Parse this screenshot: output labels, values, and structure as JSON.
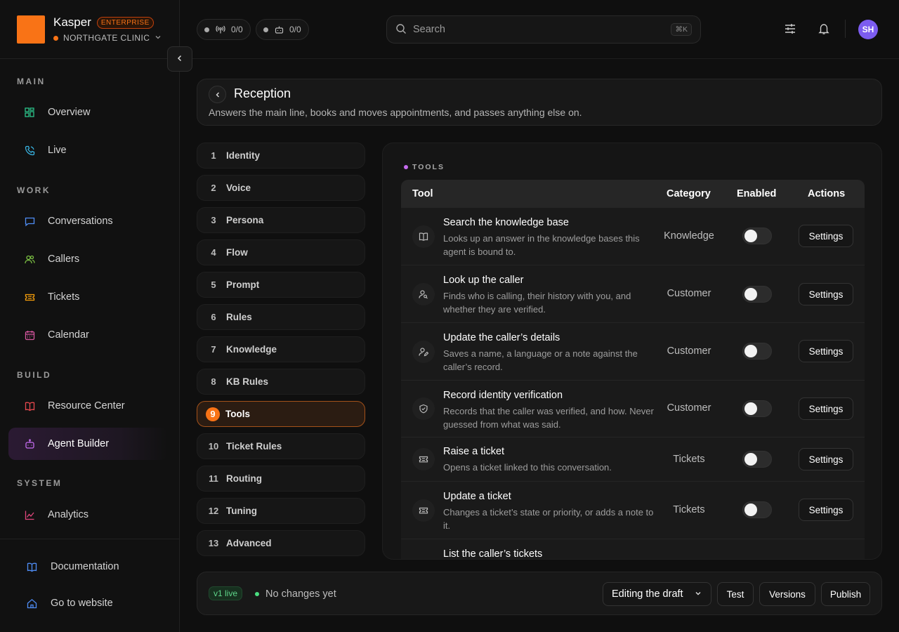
{
  "brand": {
    "name": "Kasper",
    "tier": "ENTERPRISE",
    "org": "NORTHGATE CLINIC"
  },
  "counters": [
    {
      "value": "0/0",
      "icon": "broadcast-icon"
    },
    {
      "value": "0/0",
      "icon": "bot-icon"
    }
  ],
  "search": {
    "placeholder": "Search",
    "shortcut": "⌘K"
  },
  "user": {
    "initials": "SH"
  },
  "sidebar": {
    "sections": [
      "MAIN",
      "WORK",
      "BUILD",
      "SYSTEM"
    ],
    "items": [
      {
        "label": "Overview",
        "icon": "grid-icon"
      },
      {
        "label": "Live",
        "icon": "phone-icon"
      },
      {
        "label": "Conversations",
        "icon": "message-icon"
      },
      {
        "label": "Callers",
        "icon": "users-icon"
      },
      {
        "label": "Tickets",
        "icon": "ticket-icon"
      },
      {
        "label": "Calendar",
        "icon": "calendar-icon"
      },
      {
        "label": "Resource Center",
        "icon": "book-icon"
      },
      {
        "label": "Agent Builder",
        "icon": "bot-icon",
        "active": true
      },
      {
        "label": "Analytics",
        "icon": "chart-icon"
      }
    ],
    "footer": [
      {
        "label": "Documentation",
        "icon": "book-icon"
      },
      {
        "label": "Go to website",
        "icon": "home-icon"
      }
    ]
  },
  "header": {
    "title": "Reception",
    "subtitle": "Answers the main line, books and moves appointments, and passes anything else on."
  },
  "steps": [
    {
      "num": "1",
      "label": "Identity"
    },
    {
      "num": "2",
      "label": "Voice"
    },
    {
      "num": "3",
      "label": "Persona"
    },
    {
      "num": "4",
      "label": "Flow"
    },
    {
      "num": "5",
      "label": "Prompt"
    },
    {
      "num": "6",
      "label": "Rules"
    },
    {
      "num": "7",
      "label": "Knowledge"
    },
    {
      "num": "8",
      "label": "KB Rules"
    },
    {
      "num": "9",
      "label": "Tools",
      "active": true
    },
    {
      "num": "10",
      "label": "Ticket Rules"
    },
    {
      "num": "11",
      "label": "Routing"
    },
    {
      "num": "12",
      "label": "Tuning"
    },
    {
      "num": "13",
      "label": "Advanced"
    }
  ],
  "tools": {
    "section_label": "TOOLS",
    "columns": {
      "tool": "Tool",
      "category": "Category",
      "enabled": "Enabled",
      "actions": "Actions"
    },
    "rows": [
      {
        "name": "Search the knowledge base",
        "desc": "Looks up an answer in the knowledge bases this agent is bound to.",
        "category": "Knowledge",
        "enabled": false,
        "action": "Settings",
        "icon": "book-open-icon"
      },
      {
        "name": "Look up the caller",
        "desc": "Finds who is calling, their history with you, and whether they are verified.",
        "category": "Customer",
        "enabled": false,
        "action": "Settings",
        "icon": "user-search-icon"
      },
      {
        "name": "Update the caller’s details",
        "desc": "Saves a name, a language or a note against the caller’s record.",
        "category": "Customer",
        "enabled": false,
        "action": "Settings",
        "icon": "user-edit-icon"
      },
      {
        "name": "Record identity verification",
        "desc": "Records that the caller was verified, and how. Never guessed from what was said.",
        "category": "Customer",
        "enabled": false,
        "action": "Settings",
        "icon": "shield-check-icon"
      },
      {
        "name": "Raise a ticket",
        "desc": "Opens a ticket linked to this conversation.",
        "category": "Tickets",
        "enabled": false,
        "action": "Settings",
        "icon": "ticket-icon"
      },
      {
        "name": "Update a ticket",
        "desc": "Changes a ticket’s state or priority, or adds a note to it.",
        "category": "Tickets",
        "enabled": false,
        "action": "Settings",
        "icon": "ticket-icon"
      },
      {
        "name": "List the caller’s tickets",
        "desc": "",
        "category": "",
        "enabled": false,
        "action": "",
        "icon": "list-icon"
      }
    ]
  },
  "bottom": {
    "version_badge": "v1 live",
    "status": "No changes yet",
    "mode": "Editing the draft",
    "test": "Test",
    "versions": "Versions",
    "publish": "Publish"
  }
}
